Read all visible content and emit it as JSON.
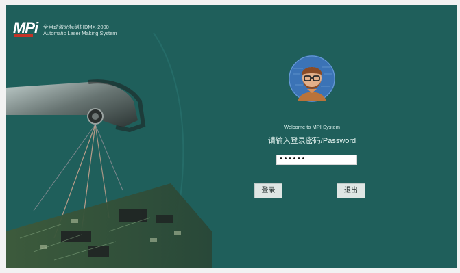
{
  "brand": {
    "logo_text": "MPi",
    "line1": "全自动激光标刻机DMX-2000",
    "line2": "Automatic Laser Making System"
  },
  "login": {
    "welcome_text": "Welcome to MPI System",
    "prompt_text": "请输入登录密码/Password",
    "password_value": "••••••",
    "login_label": "登录",
    "exit_label": "退出"
  },
  "colors": {
    "background": "#1f5f5b",
    "button_bg": "#dfe6e4",
    "logo_accent": "#c43326"
  }
}
